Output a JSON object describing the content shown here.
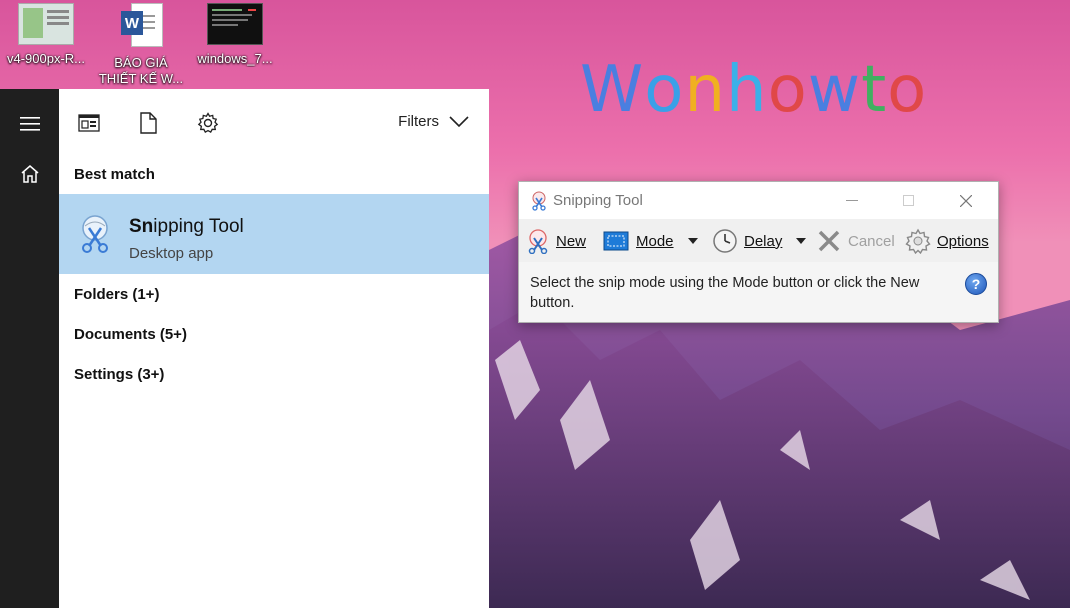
{
  "desktop": {
    "icons": [
      {
        "label": "v4-900px-R...",
        "icon": "app-screenshot-icon"
      },
      {
        "label": "BÁO GIÁ THIẾT KẾ W...",
        "icon": "word-document-icon"
      },
      {
        "label": "windows_7...",
        "icon": "terminal-screenshot-icon"
      }
    ],
    "watermark": {
      "letters": [
        {
          "ch": "W",
          "color": "#4a7fe0"
        },
        {
          "ch": "o",
          "color": "#3aa0e8"
        },
        {
          "ch": "n",
          "color": "#f0b020"
        },
        {
          "ch": "h",
          "color": "#3ab0e8"
        },
        {
          "ch": "o",
          "color": "#e04848"
        },
        {
          "ch": "w",
          "color": "#4a7fe0"
        },
        {
          "ch": "t",
          "color": "#40b060"
        },
        {
          "ch": "o",
          "color": "#e04848"
        }
      ]
    }
  },
  "start_menu": {
    "rail": [
      {
        "icon": "hamburger-menu-icon"
      },
      {
        "icon": "home-icon"
      }
    ],
    "toolbar": {
      "icons": [
        "apps-icon",
        "documents-icon",
        "settings-gear-icon"
      ],
      "filters_label": "Filters"
    },
    "best_match_header": "Best match",
    "best_match": {
      "title_bold": "Sn",
      "title_rest": "ipping Tool",
      "subtitle": "Desktop app",
      "icon": "snipping-tool-icon"
    },
    "categories": [
      "Folders (1+)",
      "Documents (5+)",
      "Settings (3+)"
    ]
  },
  "snipping_tool": {
    "title": "Snipping Tool",
    "toolbar": {
      "new_label": "New",
      "mode_label": "Mode",
      "delay_label": "Delay",
      "cancel_label": "Cancel",
      "options_label": "Options"
    },
    "message": "Select the snip mode using the Mode button or click the New button.",
    "help": "?"
  },
  "colors": {
    "rail_bg": "#1f1f1f",
    "best_match_highlight": "#b3d6f1",
    "panel_bg": "#ffffff"
  }
}
